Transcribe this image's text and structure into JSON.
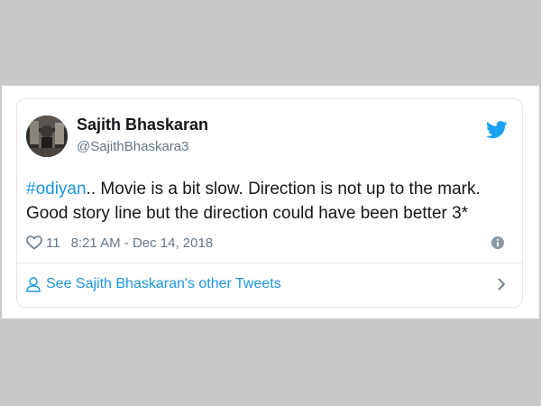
{
  "tweet": {
    "user_name": "Sajith Bhaskaran",
    "user_handle": "@SajithBhaskara3",
    "hashtag": "#odiyan",
    "text_body": ".. Movie is a bit slow. Direction is not up to the mark. Good story line but the direction could have been better 3*",
    "like_count": "11",
    "timestamp": "8:21 AM - Dec 14, 2018",
    "see_more_label": "See Sajith Bhaskaran's other Tweets"
  },
  "icons": {
    "brand": "twitter-bird-icon",
    "like": "heart-icon",
    "info": "info-icon",
    "profile": "person-icon",
    "chevron": "chevron-right-icon"
  },
  "colors": {
    "accent": "#1b95e0",
    "twitter_blue": "#1da1f2",
    "muted_text": "#657786",
    "border": "#e1e8ed",
    "backdrop": "#c9c9c9"
  }
}
